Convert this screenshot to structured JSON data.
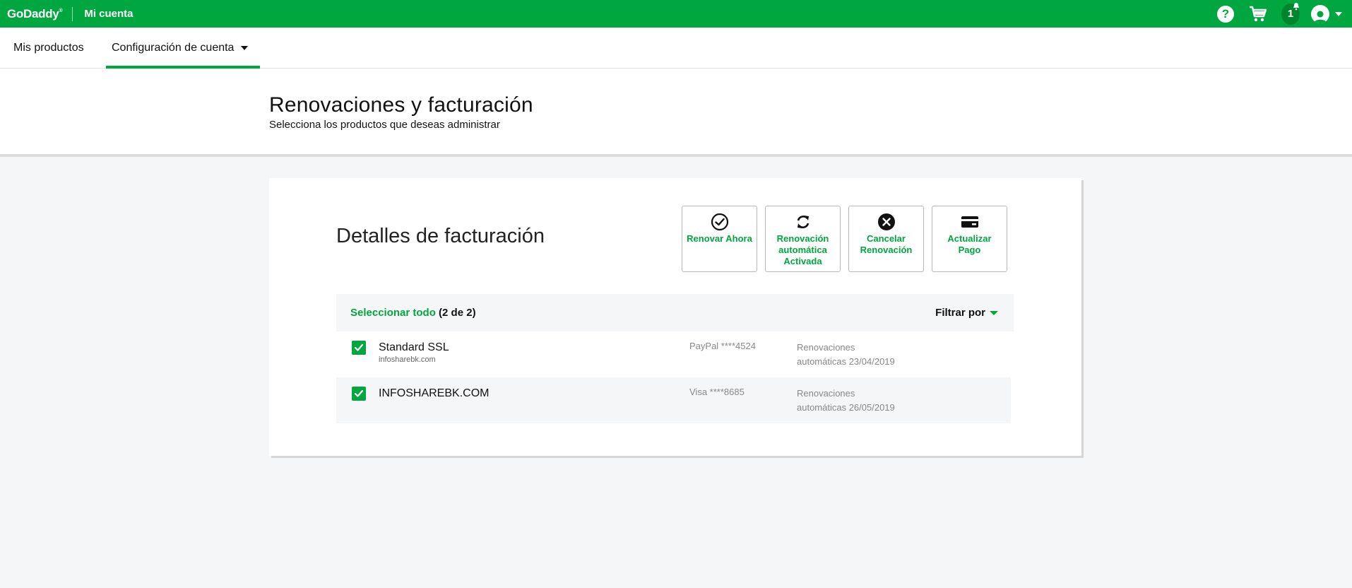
{
  "topbar": {
    "logo": "GoDaddy",
    "logo_mark": "®",
    "account_label": "Mi cuenta",
    "help_symbol": "?",
    "notification_count": "1",
    "colors": {
      "brand_green": "#00a63f",
      "dark_green": "#00852f"
    },
    "icons": [
      "help-icon",
      "cart-icon",
      "notification-bell-icon",
      "user-icon",
      "chevron-down-icon"
    ]
  },
  "subnav": {
    "products": "Mis productos",
    "account_config": "Configuración de cuenta"
  },
  "header": {
    "title": "Renovaciones y facturación",
    "subtitle": "Selecciona los productos que deseas administrar"
  },
  "card": {
    "title": "Detalles de facturación",
    "actions": [
      {
        "label": "Renovar Ahora",
        "icon": "check-circle-icon"
      },
      {
        "label": "Renovación automática Activada",
        "icon": "refresh-icon"
      },
      {
        "label": "Cancelar Renovación",
        "icon": "cancel-circle-icon"
      },
      {
        "label": "Actualizar Pago",
        "icon": "credit-card-icon"
      }
    ],
    "select_all": "Seleccionar todo",
    "select_count": "(2 de 2)",
    "filter": "Filtrar por",
    "rows": [
      {
        "name": "Standard SSL",
        "domain": "infosharebk.com",
        "payment": "PayPal ****4524",
        "renewal_line1": "Renovaciones",
        "renewal_line2": "automáticas 23/04/2019",
        "checked": true
      },
      {
        "name": "INFOSHAREBK.COM",
        "domain": "",
        "payment": "Visa ****8685",
        "renewal_line1": "Renovaciones",
        "renewal_line2": "automáticas 26/05/2019",
        "checked": true
      }
    ]
  }
}
